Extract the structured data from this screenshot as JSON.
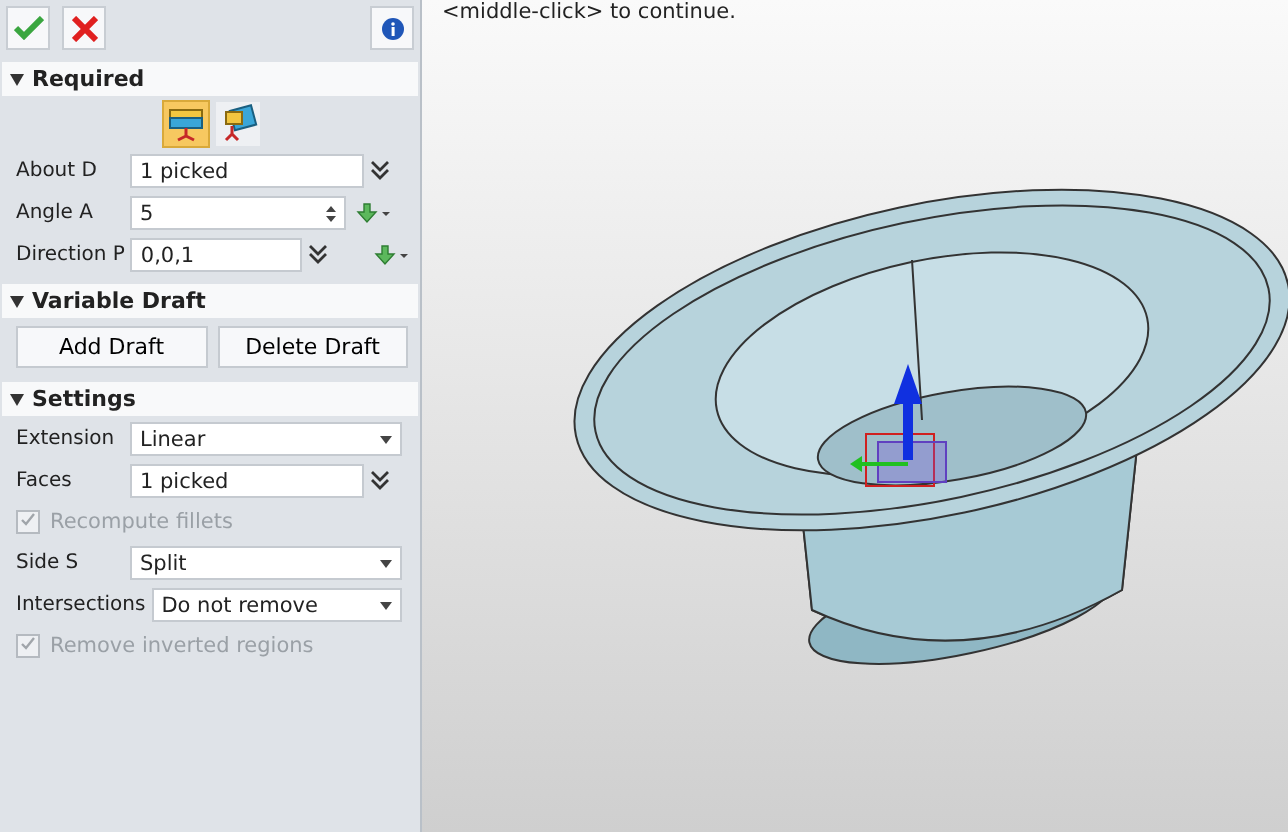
{
  "panel": {
    "sections": [
      {
        "title": "Required",
        "expanded": true,
        "rows": [
          {
            "kind": "modes",
            "modes": [
              {
                "selected": true
              },
              {
                "selected": false
              }
            ]
          },
          {
            "kind": "pick",
            "label": "About D",
            "value": "1 picked"
          },
          {
            "kind": "spin",
            "label": "Angle A",
            "value": "5"
          },
          {
            "kind": "vector",
            "label": "Direction P",
            "value": "0,0,1"
          }
        ]
      },
      {
        "title": "Variable Draft",
        "expanded": true,
        "rows": [
          {
            "kind": "buttons",
            "buttons": [
              "Add Draft",
              "Delete Draft"
            ]
          }
        ]
      },
      {
        "title": "Settings",
        "expanded": true,
        "rows": [
          {
            "kind": "select",
            "label": "Extension",
            "value": "Linear"
          },
          {
            "kind": "pick",
            "label": "Faces",
            "value": "1 picked"
          },
          {
            "kind": "checkbox",
            "label": "Recompute fillets",
            "checked": true,
            "disabled": true
          },
          {
            "kind": "select",
            "label": "Side S",
            "value": "Split"
          },
          {
            "kind": "select",
            "label": "Intersections",
            "value": "Do not remove"
          },
          {
            "kind": "checkbox",
            "label": "Remove inverted regions",
            "checked": true,
            "disabled": true
          }
        ]
      }
    ]
  },
  "viewport": {
    "prompt": "<middle-click> to continue."
  }
}
